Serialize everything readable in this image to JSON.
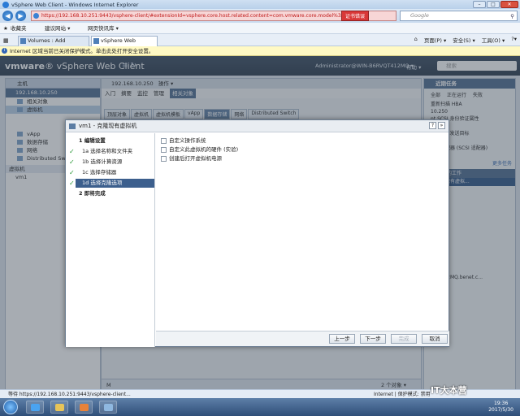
{
  "browser": {
    "window_title": "vSphere Web Client - Windows Internet Explorer",
    "address": "https://192.168.10.251:9443/vsphere-client/#extensionId=vsphere.core.host.related.content=com.vmware.core.model%3A%",
    "cert_error": "证书错误",
    "search_placeholder": "Google",
    "favorites_label": "收藏夹",
    "fav_items": [
      "建议网站 ▾",
      "网页快讯库 ▾"
    ],
    "tabs": [
      {
        "label": "Volumes : Add Volume",
        "active": false
      },
      {
        "label": "vSphere Web Client",
        "active": true
      }
    ],
    "commands": [
      "页面(P) ▾",
      "安全(S) ▾",
      "工具(O) ▾",
      "?▾"
    ],
    "infobar": "Internet 区域当前已关闭保护模式。单击此处打开安全设置。",
    "status_url": "等待 https://192.168.10.251:9443/vsphere-client...",
    "status_zone": "Internet | 保护模式: 禁用"
  },
  "vsphere": {
    "brand_bold": "vmware",
    "brand_rest": "® vSphere Web Client",
    "header_icons": "≡  ↻",
    "user": "Administrator@WIN-B6RVQT412MQ ▾",
    "help": "帮助 ▾",
    "search_placeholder": "搜索",
    "left": {
      "home": "主机",
      "host": "192.168.10.250",
      "items": [
        "相关对象",
        "虚拟机",
        "vApp",
        "数据存储",
        "网络",
        "Distributed Switch"
      ],
      "section": "虚拟机",
      "vm": "vm1"
    },
    "center": {
      "host": "192.168.10.250",
      "actions": "操作 ▾",
      "tabs": [
        "入门",
        "摘要",
        "监控",
        "管理",
        "相关对象"
      ],
      "subtabs": [
        "顶层对象",
        "虚拟机",
        "虚拟机模板",
        "vApp",
        "数据存储",
        "网络",
        "Distributed Switch"
      ],
      "footer_icon": "M",
      "count": "2 个对象 ▾"
    },
    "right": {
      "title": "近期任务",
      "tabs": [
        "全部",
        "正在运行",
        "失败"
      ],
      "lines": [
        "重新扫描 HBA",
        "10.250",
        "nt SCSI 身份验证属性",
        "10.250",
        "nt SCSI 发送目标",
        "10.250",
        "存储适配器 (SCSI 适配器)",
        "10.250"
      ],
      "more": "更多任务",
      "work_title": "进行中的工作",
      "work_item": "克隆现有虚拟...",
      "lines2": [
        "VQT412MQ.benet.c...",
        "监控"
      ]
    }
  },
  "dialog": {
    "title": "vm1 - 克隆现有虚拟机",
    "steps": [
      {
        "label": "1 编辑设置",
        "level": "main",
        "done": false,
        "current": false
      },
      {
        "label": "1a 选择名称和文件夹",
        "level": "sub",
        "done": true,
        "current": false
      },
      {
        "label": "1b 选择计算资源",
        "level": "sub",
        "done": true,
        "current": false
      },
      {
        "label": "1c 选择存储器",
        "level": "sub",
        "done": true,
        "current": false
      },
      {
        "label": "1d 选择克隆选项",
        "level": "sub",
        "done": true,
        "current": true
      },
      {
        "label": "2 即将完成",
        "level": "main",
        "done": false,
        "current": false
      }
    ],
    "options": [
      "自定义操作系统",
      "自定义此虚拟机的硬件 (实验)",
      "创建后打开虚拟机电源"
    ],
    "buttons": {
      "back": "上一步",
      "next": "下一步",
      "finish": "完成",
      "cancel": "取消"
    }
  },
  "taskbar": {
    "time": "19:36",
    "date": "2017/5/30",
    "watermark": "IT大本营"
  }
}
